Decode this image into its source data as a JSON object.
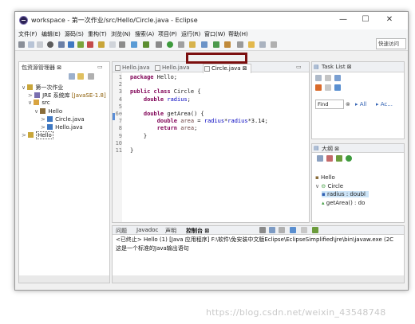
{
  "window": {
    "title": "workspace - 第一次作业/src/Hello/Circle.java - Eclipse"
  },
  "menu": [
    "文件(F)",
    "编辑(E)",
    "源码(S)",
    "重构(T)",
    "浏览(N)",
    "搜索(A)",
    "项目(P)",
    "运行(R)",
    "窗口(W)",
    "帮助(H)"
  ],
  "quick_access": "快速访问",
  "package_explorer": {
    "tab": "包资源管理器 ⊠",
    "items": [
      {
        "label": "第一次作业",
        "level": 0,
        "arrow": "∨",
        "icon": "project"
      },
      {
        "label": "JRE 系统库",
        "suffix": " [JavaSE-1.8]",
        "level": 1,
        "arrow": ">",
        "icon": "library"
      },
      {
        "label": "src",
        "level": 1,
        "arrow": "∨",
        "icon": "folder"
      },
      {
        "label": "Hello",
        "level": 2,
        "arrow": "∨",
        "icon": "package"
      },
      {
        "label": "Circle.java",
        "level": 3,
        "arrow": ">",
        "icon": "java-file"
      },
      {
        "label": "Hello.java",
        "level": 3,
        "arrow": ">",
        "icon": "java-file"
      },
      {
        "label": "Hello",
        "level": 0,
        "arrow": ">",
        "icon": "project",
        "boxed": true
      }
    ]
  },
  "editor": {
    "tabs": [
      "Hello.java",
      "Hello.java",
      "Circle.java ⊠"
    ],
    "active_tab": 2,
    "line_numbers": [
      "1",
      "2",
      "3",
      "4",
      "5",
      "6⊖",
      "7",
      "8",
      "9",
      "10",
      "11"
    ],
    "code_lines": [
      [
        [
          "kw",
          "package"
        ],
        [
          "",
          " Hello;"
        ]
      ],
      [],
      [
        [
          "kw",
          "public"
        ],
        [
          "",
          " "
        ],
        [
          "kw",
          "class"
        ],
        [
          "",
          " Circle {"
        ]
      ],
      [
        [
          "",
          "    "
        ],
        [
          "kw",
          "double"
        ],
        [
          "",
          " "
        ],
        [
          "fld",
          "radius"
        ],
        [
          "",
          ";"
        ]
      ],
      [],
      [
        [
          "",
          "    "
        ],
        [
          "kw",
          "double"
        ],
        [
          "",
          " getArea() {"
        ]
      ],
      [
        [
          "",
          "        "
        ],
        [
          "kw",
          "double"
        ],
        [
          "",
          " "
        ],
        [
          "lv",
          "area"
        ],
        [
          "",
          " = "
        ],
        [
          "fld",
          "radius"
        ],
        [
          "",
          "*"
        ],
        [
          "fld",
          "radius"
        ],
        [
          "",
          "*3.14;"
        ]
      ],
      [
        [
          "",
          "        "
        ],
        [
          "kw",
          "return"
        ],
        [
          "",
          " "
        ],
        [
          "lv",
          "area"
        ],
        [
          "",
          ";"
        ]
      ],
      [
        [
          "",
          "    }"
        ]
      ],
      [],
      [
        [
          "",
          "}"
        ]
      ]
    ]
  },
  "task_list": {
    "tab": "Task List ⊠",
    "find_label": "Find",
    "all_label": "All",
    "activate_label": "Ac..."
  },
  "outline": {
    "tab": "大纲 ⊠",
    "items": [
      {
        "label": "Hello",
        "level": 0,
        "icon": "package"
      },
      {
        "label": "Circle",
        "level": 0,
        "arrow": "∨",
        "icon": "class"
      },
      {
        "label": "radius : doubl",
        "level": 1,
        "icon": "field",
        "selected": true
      },
      {
        "label": "getArea() : do",
        "level": 1,
        "icon": "method"
      }
    ]
  },
  "bottom": {
    "tabs": [
      "问题",
      "Javadoc",
      "声明",
      "控制台 ⊠"
    ],
    "console_header": "<已终止> Hello (1) [Java 应用程序] F:\\软件\\免安装中文版Eclipse\\EclipseSimplified\\jre\\bin\\javaw.exe (2C",
    "console_output": "这是一个标准的Java输出语句"
  },
  "watermark": "https://blog.csdn.net/weixin_43548748",
  "colors": {
    "keyword": "#7f0055",
    "field": "#0000c0",
    "local": "#6a3e3e",
    "highlight_box": "#7b0f0f"
  }
}
